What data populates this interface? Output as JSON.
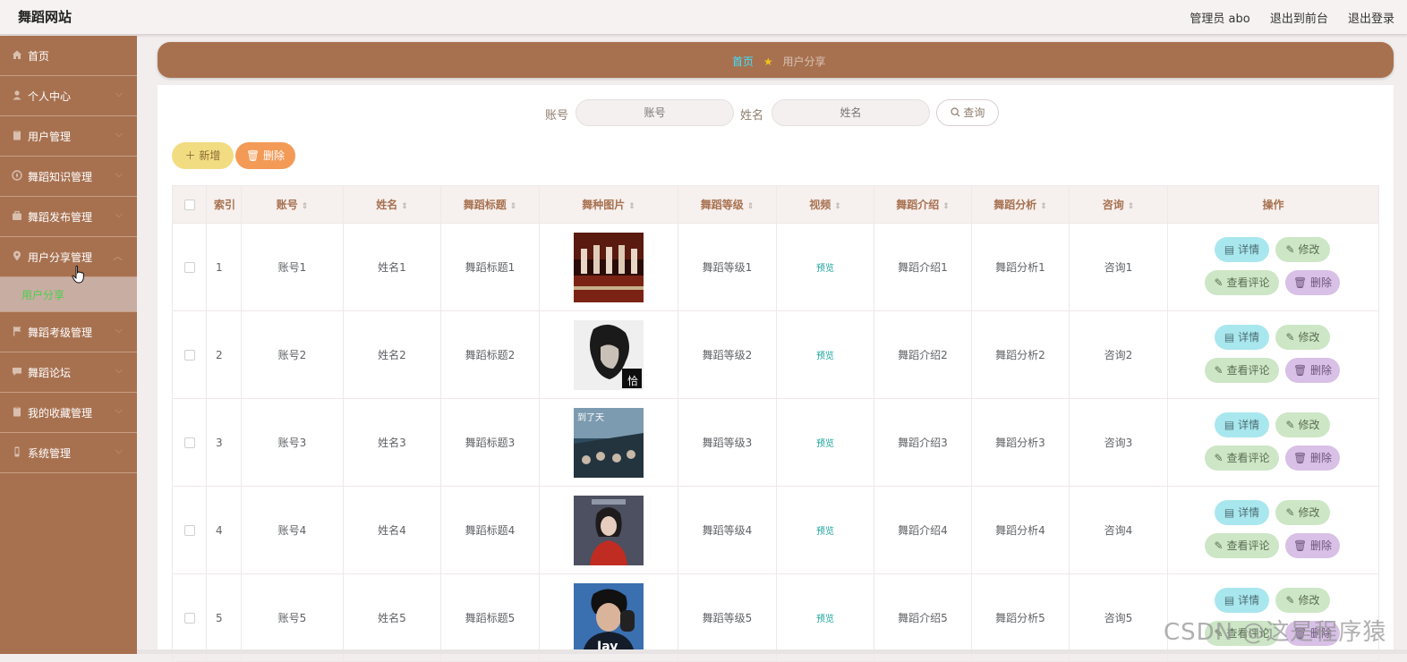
{
  "header": {
    "site_title": "舞蹈网站",
    "admin_label": "管理员 abo",
    "back_link": "退出到前台",
    "logout_link": "退出登录"
  },
  "sidebar": {
    "items": [
      {
        "label": "首页",
        "icon": "home-icon"
      },
      {
        "label": "个人中心",
        "icon": "user-icon"
      },
      {
        "label": "用户管理",
        "icon": "clipboard-icon"
      },
      {
        "label": "舞蹈知识管理",
        "icon": "compass-icon"
      },
      {
        "label": "舞蹈发布管理",
        "icon": "briefcase-icon"
      },
      {
        "label": "用户分享管理",
        "icon": "location-icon"
      },
      {
        "label": "舞蹈考级管理",
        "icon": "flag-icon"
      },
      {
        "label": "舞蹈论坛",
        "icon": "chat-icon"
      },
      {
        "label": "我的收藏管理",
        "icon": "clipboard-icon"
      },
      {
        "label": "系统管理",
        "icon": "phone-icon"
      }
    ],
    "sub_item": "用户分享"
  },
  "breadcrumb": {
    "home": "首页",
    "current": "用户分享"
  },
  "search": {
    "account_label": "账号",
    "account_placeholder": "账号",
    "name_label": "姓名",
    "name_placeholder": "姓名",
    "query_button": "查询"
  },
  "actions": {
    "add": "新增",
    "delete": "删除"
  },
  "table": {
    "headers": [
      "索引",
      "账号",
      "姓名",
      "舞蹈标题",
      "舞种图片",
      "舞蹈等级",
      "视频",
      "舞蹈介绍",
      "舞蹈分析",
      "咨询",
      "操作"
    ],
    "rows": [
      {
        "index": "1",
        "account": "账号1",
        "name": "姓名1",
        "title": "舞蹈标题1",
        "level": "舞蹈等级1",
        "video": "预览",
        "intro": "舞蹈介绍1",
        "analysis": "舞蹈分析1",
        "consult": "咨询1"
      },
      {
        "index": "2",
        "account": "账号2",
        "name": "姓名2",
        "title": "舞蹈标题2",
        "level": "舞蹈等级2",
        "video": "预览",
        "intro": "舞蹈介绍2",
        "analysis": "舞蹈分析2",
        "consult": "咨询2"
      },
      {
        "index": "3",
        "account": "账号3",
        "name": "姓名3",
        "title": "舞蹈标题3",
        "level": "舞蹈等级3",
        "video": "预览",
        "intro": "舞蹈介绍3",
        "analysis": "舞蹈分析3",
        "consult": "咨询3"
      },
      {
        "index": "4",
        "account": "账号4",
        "name": "姓名4",
        "title": "舞蹈标题4",
        "level": "舞蹈等级4",
        "video": "预览",
        "intro": "舞蹈介绍4",
        "analysis": "舞蹈分析4",
        "consult": "咨询4"
      },
      {
        "index": "5",
        "account": "账号5",
        "name": "姓名5",
        "title": "舞蹈标题5",
        "level": "舞蹈等级5",
        "video": "预览",
        "intro": "舞蹈介绍5",
        "analysis": "舞蹈分析5",
        "consult": "咨询5"
      }
    ],
    "row_buttons": {
      "detail": "详情",
      "edit": "修改",
      "comments": "查看评论",
      "remove": "删除"
    }
  },
  "thumbnails": [
    {
      "description": "dancers on stage",
      "alt": ""
    },
    {
      "description": "album cover portrait",
      "alt": ""
    },
    {
      "description": "crowd poster",
      "alt": ""
    },
    {
      "description": "girl portrait",
      "alt": ""
    },
    {
      "description": "Jay album cover",
      "alt": "Jay"
    }
  ],
  "watermark": "CSDN @这是程序猿",
  "colors": {
    "sidebar": "#a77150",
    "accent_home": "#3ee0ff",
    "add_button": "#f2dc82",
    "delete_button": "#f39a57",
    "detail_button": "#a9e7ee",
    "edit_button": "#cde6c6",
    "remove_button": "#d8c0e6",
    "preview_link": "#1aa39a"
  }
}
